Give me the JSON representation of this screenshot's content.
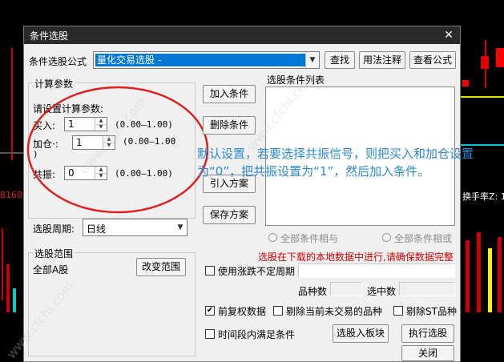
{
  "window": {
    "title": "条件选股",
    "close_label": "✕"
  },
  "formula": {
    "label": "条件选股公式",
    "selected": "量化交易选股 -",
    "buttons": {
      "find": "查找",
      "usage": "用法注释",
      "view": "查看公式"
    }
  },
  "params": {
    "group_title": "计算参数",
    "prompt": "请设置计算参数:",
    "rows": [
      {
        "label": "买入:",
        "value": "1",
        "range": "(0.00—1.00)"
      },
      {
        "label": "加仓·:",
        "value": "1",
        "range": "(0.00—1.00",
        "range_tail": ")"
      },
      {
        "label": "共振:",
        "value": "0",
        "range": "(0.00—1.00)"
      }
    ]
  },
  "period": {
    "label": "选股周期:",
    "value": "日线"
  },
  "scope": {
    "group_title": "选股范围",
    "value": "全部A股",
    "change_button": "改变范围"
  },
  "actions": {
    "add": "加入条件",
    "delete": "删除条件",
    "import": "引入方案",
    "save": "保存方案"
  },
  "condition_list": {
    "label": "选股条件列表"
  },
  "logic": {
    "and": "全部条件相与",
    "or": "全部条件相或"
  },
  "warning": "选股在下载的本地数据中进行,请确保数据完整",
  "options": {
    "uncertain_period": "使用涨跌不定周期",
    "count_label": "品种数",
    "selected_label": "选中数",
    "restored": "前复权数据",
    "exclude_untraded": "剔除当前未交易的品种",
    "exclude_st": "剔除ST品种",
    "interval": "时间段内满足条件"
  },
  "bottom_buttons": {
    "to_block": "选股入板块",
    "run": "执行选股",
    "close": "关闭"
  },
  "annotation": {
    "line1": "默认设置，若要选择共振信号，则把买入和加仓设置",
    "line2": "为“0”，把共振设置为“1”，然后加入条件。"
  },
  "background": {
    "left_number": "8168",
    "right_label": "换手率Z: 1"
  },
  "watermark": "www.cfchi.com",
  "colors": {
    "accent": "#0078d7",
    "warning": "#d40000",
    "annotation": "#2b8ad6",
    "ellipse": "#e02020"
  }
}
